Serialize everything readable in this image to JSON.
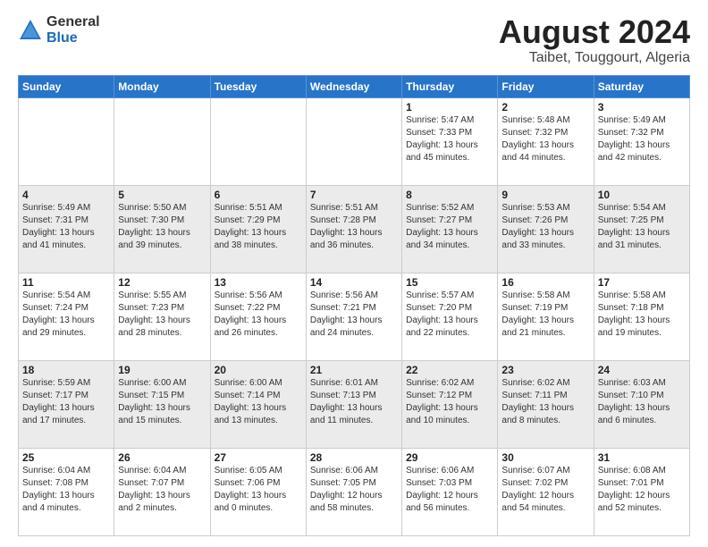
{
  "header": {
    "logo_line1": "General",
    "logo_line2": "Blue",
    "month_year": "August 2024",
    "location": "Taibet, Touggourt, Algeria"
  },
  "days_of_week": [
    "Sunday",
    "Monday",
    "Tuesday",
    "Wednesday",
    "Thursday",
    "Friday",
    "Saturday"
  ],
  "weeks": [
    [
      {
        "day": "",
        "info": ""
      },
      {
        "day": "",
        "info": ""
      },
      {
        "day": "",
        "info": ""
      },
      {
        "day": "",
        "info": ""
      },
      {
        "day": "1",
        "info": "Sunrise: 5:47 AM\nSunset: 7:33 PM\nDaylight: 13 hours\nand 45 minutes."
      },
      {
        "day": "2",
        "info": "Sunrise: 5:48 AM\nSunset: 7:32 PM\nDaylight: 13 hours\nand 44 minutes."
      },
      {
        "day": "3",
        "info": "Sunrise: 5:49 AM\nSunset: 7:32 PM\nDaylight: 13 hours\nand 42 minutes."
      }
    ],
    [
      {
        "day": "4",
        "info": "Sunrise: 5:49 AM\nSunset: 7:31 PM\nDaylight: 13 hours\nand 41 minutes."
      },
      {
        "day": "5",
        "info": "Sunrise: 5:50 AM\nSunset: 7:30 PM\nDaylight: 13 hours\nand 39 minutes."
      },
      {
        "day": "6",
        "info": "Sunrise: 5:51 AM\nSunset: 7:29 PM\nDaylight: 13 hours\nand 38 minutes."
      },
      {
        "day": "7",
        "info": "Sunrise: 5:51 AM\nSunset: 7:28 PM\nDaylight: 13 hours\nand 36 minutes."
      },
      {
        "day": "8",
        "info": "Sunrise: 5:52 AM\nSunset: 7:27 PM\nDaylight: 13 hours\nand 34 minutes."
      },
      {
        "day": "9",
        "info": "Sunrise: 5:53 AM\nSunset: 7:26 PM\nDaylight: 13 hours\nand 33 minutes."
      },
      {
        "day": "10",
        "info": "Sunrise: 5:54 AM\nSunset: 7:25 PM\nDaylight: 13 hours\nand 31 minutes."
      }
    ],
    [
      {
        "day": "11",
        "info": "Sunrise: 5:54 AM\nSunset: 7:24 PM\nDaylight: 13 hours\nand 29 minutes."
      },
      {
        "day": "12",
        "info": "Sunrise: 5:55 AM\nSunset: 7:23 PM\nDaylight: 13 hours\nand 28 minutes."
      },
      {
        "day": "13",
        "info": "Sunrise: 5:56 AM\nSunset: 7:22 PM\nDaylight: 13 hours\nand 26 minutes."
      },
      {
        "day": "14",
        "info": "Sunrise: 5:56 AM\nSunset: 7:21 PM\nDaylight: 13 hours\nand 24 minutes."
      },
      {
        "day": "15",
        "info": "Sunrise: 5:57 AM\nSunset: 7:20 PM\nDaylight: 13 hours\nand 22 minutes."
      },
      {
        "day": "16",
        "info": "Sunrise: 5:58 AM\nSunset: 7:19 PM\nDaylight: 13 hours\nand 21 minutes."
      },
      {
        "day": "17",
        "info": "Sunrise: 5:58 AM\nSunset: 7:18 PM\nDaylight: 13 hours\nand 19 minutes."
      }
    ],
    [
      {
        "day": "18",
        "info": "Sunrise: 5:59 AM\nSunset: 7:17 PM\nDaylight: 13 hours\nand 17 minutes."
      },
      {
        "day": "19",
        "info": "Sunrise: 6:00 AM\nSunset: 7:15 PM\nDaylight: 13 hours\nand 15 minutes."
      },
      {
        "day": "20",
        "info": "Sunrise: 6:00 AM\nSunset: 7:14 PM\nDaylight: 13 hours\nand 13 minutes."
      },
      {
        "day": "21",
        "info": "Sunrise: 6:01 AM\nSunset: 7:13 PM\nDaylight: 13 hours\nand 11 minutes."
      },
      {
        "day": "22",
        "info": "Sunrise: 6:02 AM\nSunset: 7:12 PM\nDaylight: 13 hours\nand 10 minutes."
      },
      {
        "day": "23",
        "info": "Sunrise: 6:02 AM\nSunset: 7:11 PM\nDaylight: 13 hours\nand 8 minutes."
      },
      {
        "day": "24",
        "info": "Sunrise: 6:03 AM\nSunset: 7:10 PM\nDaylight: 13 hours\nand 6 minutes."
      }
    ],
    [
      {
        "day": "25",
        "info": "Sunrise: 6:04 AM\nSunset: 7:08 PM\nDaylight: 13 hours\nand 4 minutes."
      },
      {
        "day": "26",
        "info": "Sunrise: 6:04 AM\nSunset: 7:07 PM\nDaylight: 13 hours\nand 2 minutes."
      },
      {
        "day": "27",
        "info": "Sunrise: 6:05 AM\nSunset: 7:06 PM\nDaylight: 13 hours\nand 0 minutes."
      },
      {
        "day": "28",
        "info": "Sunrise: 6:06 AM\nSunset: 7:05 PM\nDaylight: 12 hours\nand 58 minutes."
      },
      {
        "day": "29",
        "info": "Sunrise: 6:06 AM\nSunset: 7:03 PM\nDaylight: 12 hours\nand 56 minutes."
      },
      {
        "day": "30",
        "info": "Sunrise: 6:07 AM\nSunset: 7:02 PM\nDaylight: 12 hours\nand 54 minutes."
      },
      {
        "day": "31",
        "info": "Sunrise: 6:08 AM\nSunset: 7:01 PM\nDaylight: 12 hours\nand 52 minutes."
      }
    ]
  ]
}
